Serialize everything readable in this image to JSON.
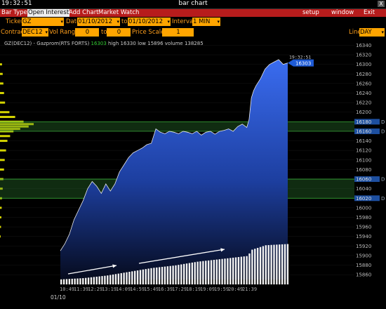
{
  "window": {
    "clock": "19:32:51",
    "title": "bar chart",
    "close_label": "X"
  },
  "menu": {
    "items": [
      "Bar Type",
      "Open Interest",
      "Add Chart",
      "Market Watch"
    ],
    "selected": "Open Interest",
    "right_items": [
      "setup",
      "window",
      "Exit"
    ]
  },
  "params": {
    "ticker_label": "Ticker",
    "ticker_value": "GZ",
    "date_label": "Date",
    "date_from": "01/10/2012",
    "to_label": "to",
    "date_to": "01/10/2012",
    "interval_label": "Interval",
    "interval_value": "1 MIN",
    "contract_label": "Contract",
    "contract_value": "DEC12",
    "vol_range_label": "Vol Range",
    "vol_from": "0",
    "vol_to_label": "to",
    "vol_to": "0",
    "price_scale_label": "Price Scale",
    "price_scale_value": "1",
    "line_label": "Line",
    "line_value": "DAY"
  },
  "info": {
    "symbol": "GZ(DEC12) - Gazprom(RTS FORTS)",
    "last": "16303",
    "high_label": "high",
    "high": "16330",
    "low_label": "low",
    "low": "15896",
    "volume_label": "volume",
    "volume": "138285"
  },
  "colors": {
    "menu_bg": "#b71c1c",
    "field_bg": "#ffa500",
    "label": "#ff9f1c",
    "price_marker": "#1e5bd6",
    "band": "#2e7d32",
    "profile": "#d4d400"
  },
  "chart_data": {
    "type": "area",
    "price_axis_labels": [
      "16340",
      "16320",
      "16300",
      "16280",
      "16260",
      "16240",
      "16220",
      "16200",
      "16180",
      "16160",
      "16140",
      "16120",
      "16100",
      "16080",
      "16060",
      "16040",
      "16020",
      "16000",
      "15980",
      "15960",
      "15940",
      "15920",
      "15900",
      "15880",
      "15860"
    ],
    "time_labels": [
      "10:49",
      "11:39",
      "12:29",
      "13:19",
      "14:09",
      "14:59",
      "15:49",
      "16:39",
      "17:29",
      "18:19",
      "19:09",
      "19:59",
      "20:49",
      "21:39"
    ],
    "date_label": "01/10",
    "last_price": "16303",
    "last_time": "19:32:51",
    "band_labels": [
      {
        "price": 16180,
        "text": "16180",
        "suffix": "D"
      },
      {
        "price": 16160,
        "text": "16160",
        "suffix": "D"
      },
      {
        "price": 16060,
        "text": "16060",
        "suffix": "D"
      },
      {
        "price": 16020,
        "text": "16020",
        "suffix": "D"
      }
    ],
    "price_series": [
      [
        0,
        15910
      ],
      [
        2,
        15925
      ],
      [
        4,
        15945
      ],
      [
        6,
        15975
      ],
      [
        8,
        15995
      ],
      [
        10,
        16015
      ],
      [
        12,
        16040
      ],
      [
        14,
        16055
      ],
      [
        16,
        16045
      ],
      [
        18,
        16030
      ],
      [
        20,
        16050
      ],
      [
        22,
        16035
      ],
      [
        24,
        16050
      ],
      [
        26,
        16075
      ],
      [
        28,
        16090
      ],
      [
        30,
        16105
      ],
      [
        32,
        16115
      ],
      [
        34,
        16120
      ],
      [
        36,
        16125
      ],
      [
        38,
        16132
      ],
      [
        40,
        16135
      ],
      [
        42,
        16165
      ],
      [
        44,
        16158
      ],
      [
        46,
        16155
      ],
      [
        48,
        16160
      ],
      [
        50,
        16158
      ],
      [
        52,
        16155
      ],
      [
        54,
        16160
      ],
      [
        56,
        16158
      ],
      [
        58,
        16155
      ],
      [
        60,
        16160
      ],
      [
        62,
        16152
      ],
      [
        64,
        16158
      ],
      [
        66,
        16160
      ],
      [
        68,
        16154
      ],
      [
        70,
        16160
      ],
      [
        72,
        16162
      ],
      [
        74,
        16165
      ],
      [
        76,
        16160
      ],
      [
        78,
        16170
      ],
      [
        80,
        16175
      ],
      [
        82,
        16168
      ],
      [
        83,
        16185
      ],
      [
        84,
        16230
      ],
      [
        85,
        16245
      ],
      [
        86,
        16255
      ],
      [
        88,
        16270
      ],
      [
        90,
        16290
      ],
      [
        92,
        16300
      ],
      [
        94,
        16305
      ],
      [
        96,
        16310
      ],
      [
        98,
        16300
      ],
      [
        100,
        16303
      ]
    ],
    "volume_series": [
      [
        0,
        0.08
      ],
      [
        10,
        0.1
      ],
      [
        20,
        0.14
      ],
      [
        30,
        0.2
      ],
      [
        40,
        0.26
      ],
      [
        50,
        0.3
      ],
      [
        60,
        0.36
      ],
      [
        70,
        0.4
      ],
      [
        82,
        0.45
      ],
      [
        84,
        0.55
      ],
      [
        90,
        0.62
      ],
      [
        100,
        0.64
      ]
    ],
    "profile": [
      [
        16300,
        0.06
      ],
      [
        16280,
        0.08
      ],
      [
        16260,
        0.1
      ],
      [
        16240,
        0.12
      ],
      [
        16220,
        0.15
      ],
      [
        16200,
        0.28
      ],
      [
        16190,
        0.45
      ],
      [
        16180,
        0.7
      ],
      [
        16175,
        1.0
      ],
      [
        16170,
        0.85
      ],
      [
        16165,
        0.6
      ],
      [
        16160,
        0.4
      ],
      [
        16150,
        0.3
      ],
      [
        16140,
        0.22
      ],
      [
        16120,
        0.18
      ],
      [
        16100,
        0.14
      ],
      [
        16080,
        0.12
      ],
      [
        16060,
        0.1
      ],
      [
        16040,
        0.08
      ],
      [
        16020,
        0.06
      ],
      [
        16000,
        0.05
      ],
      [
        15980,
        0.04
      ],
      [
        15960,
        0.03
      ],
      [
        15940,
        0.02
      ]
    ]
  }
}
